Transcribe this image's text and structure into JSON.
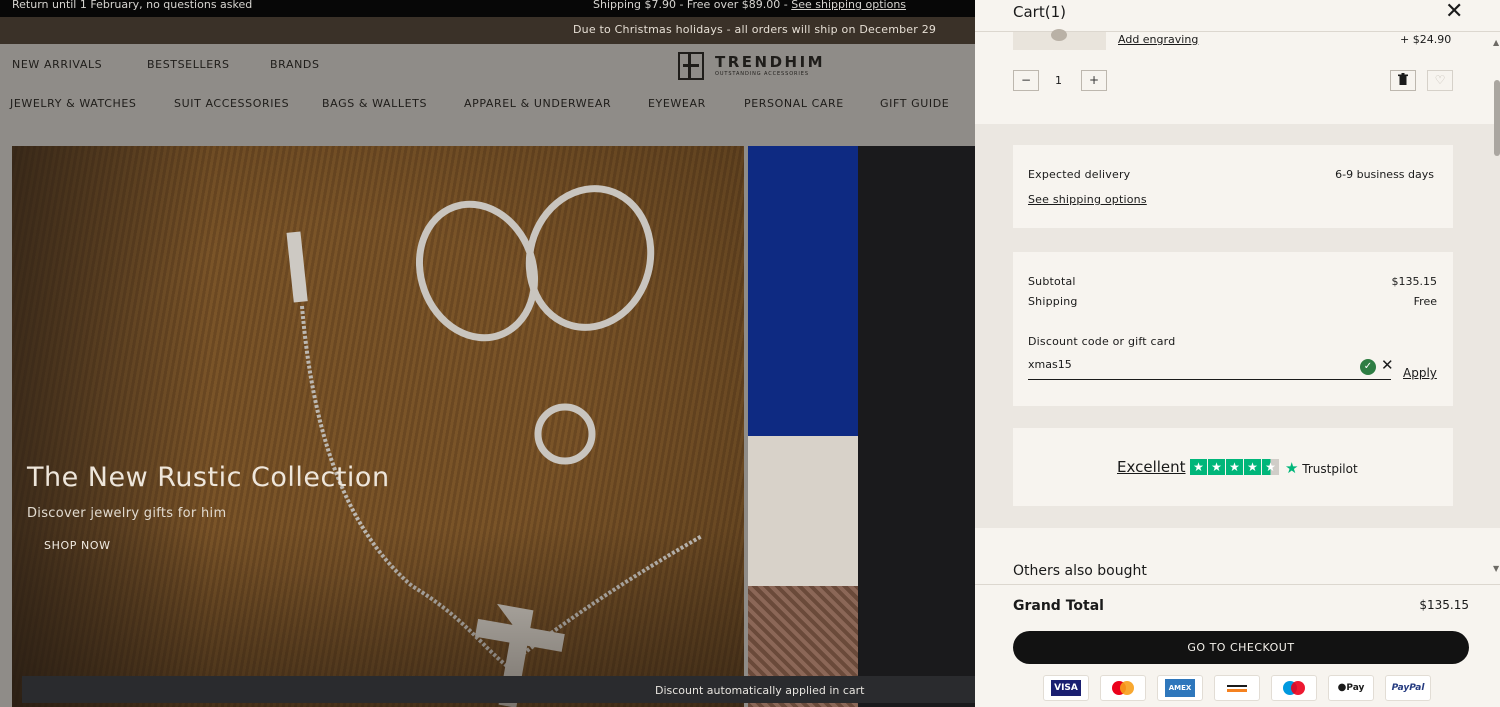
{
  "topbar": {
    "left_text": "Return until 1 February, no questions asked",
    "shipping_text": "Shipping $7.90 - Free over $89.00 - ",
    "shipping_link": "See shipping options"
  },
  "holiday_notice": "Due to Christmas holidays - all orders will ship on December 29",
  "header": {
    "main_nav": [
      "NEW ARRIVALS",
      "BESTSELLERS",
      "BRANDS"
    ],
    "logo_word": "TRENDHIM",
    "logo_tagline": "OUTSTANDING ACCESSORIES",
    "category_nav": [
      "JEWELRY & WATCHES",
      "SUIT ACCESSORIES",
      "BAGS & WALLETS",
      "APPAREL & UNDERWEAR",
      "EYEWEAR",
      "PERSONAL CARE",
      "GIFT GUIDE"
    ]
  },
  "hero": {
    "title": "The New Rustic Collection",
    "subtitle": "Discover jewelry gifts for him",
    "cta": "SHOP NOW"
  },
  "promo_strip": "Discount automatically applied in cart",
  "cart": {
    "title": "Cart(1)",
    "item": {
      "engraving_link": "Add engraving",
      "engraving_price": "+ $24.90",
      "quantity": "1",
      "decrement_symbol": "−",
      "increment_symbol": "+"
    },
    "delivery": {
      "label": "Expected delivery",
      "value": "6-9 business days",
      "link": "See shipping options"
    },
    "summary": {
      "subtotal_label": "Subtotal",
      "subtotal_value": "$135.15",
      "shipping_label": "Shipping",
      "shipping_value": "Free",
      "discount_label": "Discount code or gift card",
      "discount_value": "xmas15",
      "apply_label": "Apply"
    },
    "trustpilot": {
      "rating_word": "Excellent",
      "brand": "Trustpilot",
      "stars": 4.5
    },
    "others_title": "Others also bought",
    "grand_total_label": "Grand Total",
    "grand_total_value": "$135.15",
    "checkout_label": "GO TO CHECKOUT",
    "payment_methods": [
      "VISA",
      "Mastercard",
      "AMEX",
      "Discover",
      "Maestro",
      "Apple Pay",
      "PayPal"
    ]
  },
  "colors": {
    "accent_green": "#2e7d43",
    "trustpilot_green": "#00b67a",
    "checkout_black": "#121212"
  }
}
